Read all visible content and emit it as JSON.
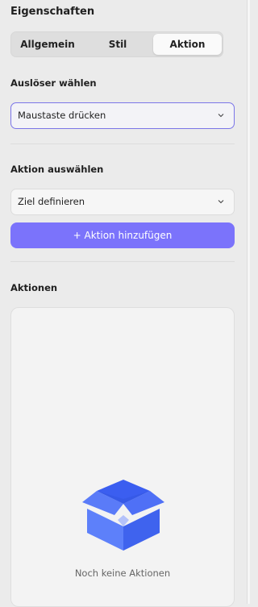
{
  "panel": {
    "title": "Eigenschaften"
  },
  "tabs": [
    {
      "label": "Allgemein",
      "selected": false
    },
    {
      "label": "Stil",
      "selected": false
    },
    {
      "label": "Aktion",
      "selected": true
    }
  ],
  "trigger": {
    "label": "Auslöser wählen",
    "value": "Maustaste drücken",
    "icon": "chevron-down-icon"
  },
  "action_select": {
    "label": "Aktion auswählen",
    "value": "Ziel definieren",
    "icon": "chevron-down-icon"
  },
  "add_button": {
    "label": "+ Aktion hinzufügen"
  },
  "actions": {
    "label": "Aktionen",
    "empty_text": "Noch keine Aktionen",
    "empty_icon": "open-box-icon"
  },
  "colors": {
    "accent": "#7b73fb",
    "focus_border": "#7b75e8",
    "box_blue": "#4a6cf5"
  }
}
